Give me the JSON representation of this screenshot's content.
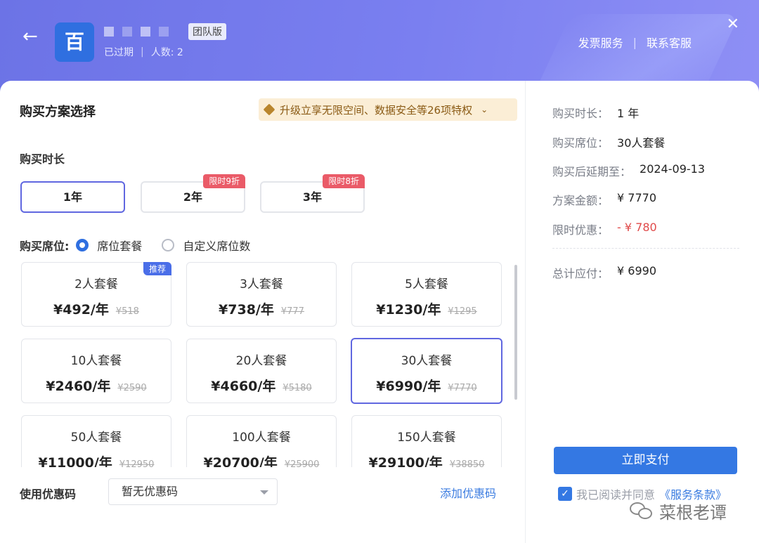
{
  "header": {
    "logo_char": "百",
    "team_badge": "团队版",
    "status_text": "已过期",
    "members_text": "人数: 2",
    "links": [
      "发票服务",
      "联系客服"
    ],
    "sep": "|"
  },
  "plan": {
    "title": "购买方案选择",
    "promo_text": "升级立享无限空间、数据安全等26项特权",
    "duration_label": "购买时长",
    "durations": [
      {
        "label": "1年",
        "tag": "",
        "active": true
      },
      {
        "label": "2年",
        "tag": "限时9折",
        "active": false
      },
      {
        "label": "3年",
        "tag": "限时8折",
        "active": false
      }
    ],
    "seat_label": "购买席位:",
    "seat_options": [
      "席位套餐",
      "自定义席位数"
    ],
    "packages": [
      {
        "name": "2人套餐",
        "price": "¥492/年",
        "orig": "¥518",
        "tag": "推荐"
      },
      {
        "name": "3人套餐",
        "price": "¥738/年",
        "orig": "¥777",
        "tag": ""
      },
      {
        "name": "5人套餐",
        "price": "¥1230/年",
        "orig": "¥1295",
        "tag": ""
      },
      {
        "name": "10人套餐",
        "price": "¥2460/年",
        "orig": "¥2590",
        "tag": ""
      },
      {
        "name": "20人套餐",
        "price": "¥4660/年",
        "orig": "¥5180",
        "tag": ""
      },
      {
        "name": "30人套餐",
        "price": "¥6990/年",
        "orig": "¥7770",
        "tag": "",
        "selected": true
      },
      {
        "name": "50人套餐",
        "price": "¥11000/年",
        "orig": "¥12950",
        "tag": ""
      },
      {
        "name": "100人套餐",
        "price": "¥20700/年",
        "orig": "¥25900",
        "tag": ""
      },
      {
        "name": "150人套餐",
        "price": "¥29100/年",
        "orig": "¥38850",
        "tag": ""
      }
    ],
    "coupon_label": "使用优惠码",
    "coupon_value": "暂无优惠码",
    "add_coupon": "添加优惠码"
  },
  "summary": {
    "duration_k": "购买时长：",
    "duration_v": "1 年",
    "seats_k": "购买席位：",
    "seats_v": "30人套餐",
    "extend_k": "购买后延期至：",
    "extend_v": "2024-09-13",
    "amount_k": "方案金额：",
    "amount_v": "¥ 7770",
    "discount_k": "限时优惠：",
    "discount_v": "- ¥ 780",
    "total_k": "总计应付：",
    "total_v": "¥ 6990",
    "pay_label": "立即支付",
    "agree_text": "我已阅读并同意",
    "terms_text": "《服务条款》"
  },
  "watermark": "菜根老谭"
}
